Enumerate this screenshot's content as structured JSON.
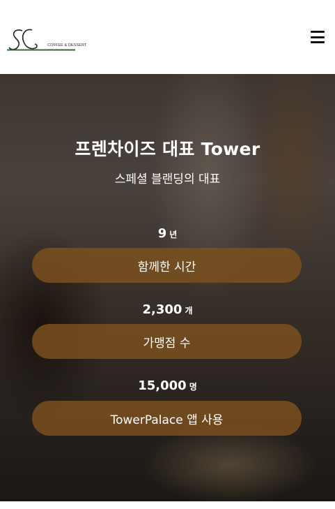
{
  "header": {
    "logo_text": "COFFEE & DESSERT",
    "menu_icon": "hamburger-menu-icon"
  },
  "hero": {
    "title": "프렌차이즈 대표 Tower",
    "subtitle": "스페셜 블랜딩의 대표"
  },
  "stats": [
    {
      "value": "9",
      "unit": "년",
      "label": "함께한 시간"
    },
    {
      "value": "2,300",
      "unit": "개",
      "label": "가맹점 수"
    },
    {
      "value": "15,000",
      "unit": "명",
      "label": "TowerPalace 앱 사용"
    }
  ],
  "colors": {
    "pill": "#7e521e",
    "logo_green": "#2f6b3a"
  }
}
